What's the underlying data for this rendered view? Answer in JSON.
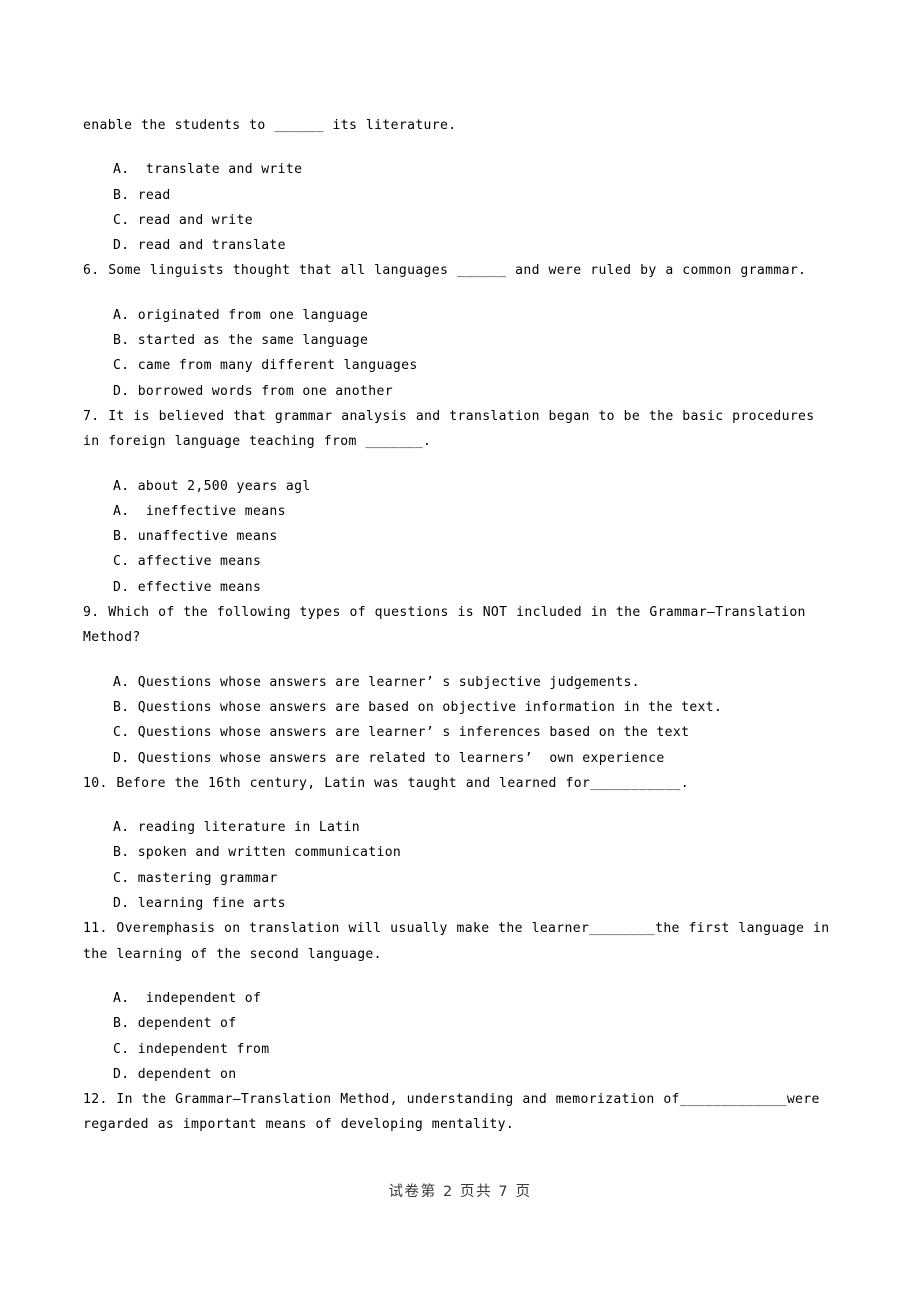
{
  "page": {
    "background_color": "#ffffff",
    "text_color": "#000000",
    "footer_color": "#3a3a3a"
  },
  "blocks": [
    {
      "kind": "stem-continuation",
      "text": "enable the students to ______ its literature.",
      "options": [
        "A.  translate and write",
        "B. read",
        "C. read and write",
        "D. read and translate"
      ]
    },
    {
      "kind": "question",
      "number": "6.",
      "text": "6. Some linguists thought that all languages ______ and were ruled by a common grammar.",
      "options": [
        "A. originated from one language",
        "B. started as the same language",
        "C. came from many different languages",
        "D. borrowed words from one another"
      ]
    },
    {
      "kind": "question",
      "number": "7.",
      "text": "7. It is believed that grammar analysis and translation began to be the basic procedures in foreign language teaching from _______.",
      "options": [
        "A. about 2,500 years agl",
        "A.  ineffective means",
        "B. unaffective means",
        "C. affective means",
        "D. effective means"
      ]
    },
    {
      "kind": "question",
      "number": "9.",
      "text": "9. Which of the following types of questions is NOT included in the Grammar—Translation Method?",
      "options": [
        "A. Questions whose answers are learner’ s subjective judgements.",
        "B. Questions whose answers are based on objective information in the text.",
        "C. Questions whose answers are learner’ s inferences based on the text",
        "D. Questions whose answers are related to learners’  own experience"
      ]
    },
    {
      "kind": "question",
      "number": "10.",
      "text": "10. Before the 16th century, Latin was taught and learned for___________.",
      "options": [
        "A. reading literature in Latin",
        "B. spoken and written communication",
        "C. mastering grammar",
        "D. learning fine arts"
      ]
    },
    {
      "kind": "question",
      "number": "11.",
      "text": "11. Overemphasis on translation will usually make the learner________the first language in the learning of the second language.",
      "options": [
        "A.  independent of",
        "B. dependent of",
        "C. independent from",
        "D. dependent on"
      ]
    },
    {
      "kind": "question",
      "number": "12.",
      "text": "12. In the Grammar—Translation Method, understanding and memorization of_____________were regarded as important means of developing mentality.",
      "options": []
    }
  ],
  "footer": {
    "text": "试卷第 2 页共 7 页",
    "current_page": "2",
    "total_pages": "7"
  }
}
